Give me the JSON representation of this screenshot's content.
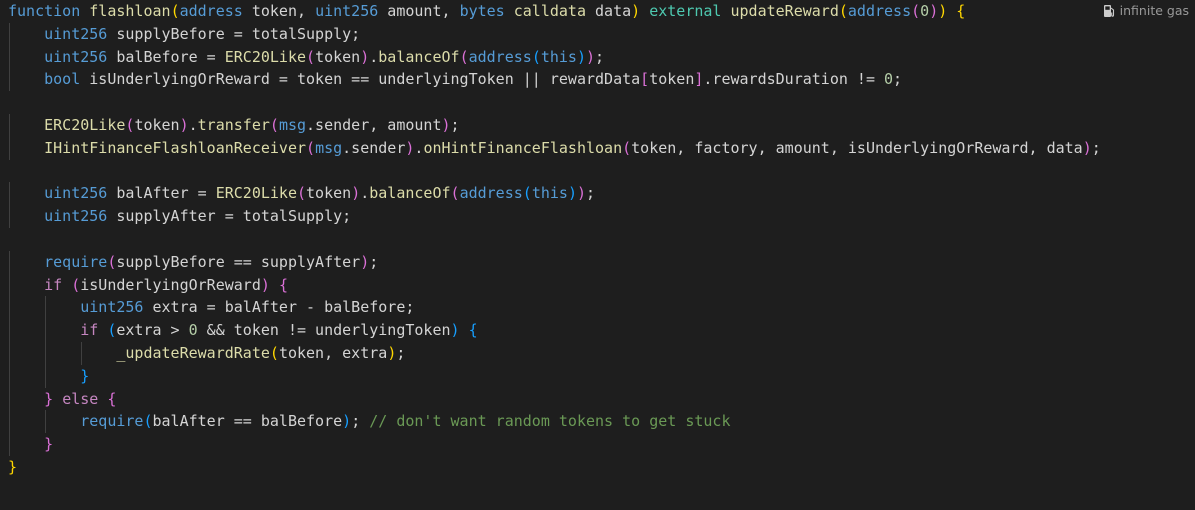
{
  "editor": {
    "codelens": {
      "icon": "fuel-pump-icon",
      "label": "infinite gas"
    },
    "theme": {
      "background": "#1e1e1e",
      "keyword": "#569cd6",
      "control": "#c586c0",
      "function": "#dcdcaa",
      "number": "#b5cea8",
      "comment": "#6a9955"
    },
    "lines": [
      [
        {
          "t": "function",
          "c": "kw"
        },
        {
          "t": " ",
          "c": "pl"
        },
        {
          "t": "flashloan",
          "c": "fn"
        },
        {
          "t": "(",
          "c": "b1"
        },
        {
          "t": "address",
          "c": "kw"
        },
        {
          "t": " token, ",
          "c": "pl"
        },
        {
          "t": "uint256",
          "c": "kw"
        },
        {
          "t": " amount, ",
          "c": "pl"
        },
        {
          "t": "bytes",
          "c": "kw"
        },
        {
          "t": " ",
          "c": "pl"
        },
        {
          "t": "calldata",
          "c": "fn"
        },
        {
          "t": " data",
          "c": "pl"
        },
        {
          "t": ")",
          "c": "b1"
        },
        {
          "t": " ",
          "c": "pl"
        },
        {
          "t": "external",
          "c": "mod"
        },
        {
          "t": " ",
          "c": "pl"
        },
        {
          "t": "updateReward",
          "c": "fn"
        },
        {
          "t": "(",
          "c": "b1"
        },
        {
          "t": "address",
          "c": "kw"
        },
        {
          "t": "(",
          "c": "b2"
        },
        {
          "t": "0",
          "c": "num"
        },
        {
          "t": ")",
          "c": "b2"
        },
        {
          "t": ")",
          "c": "b1"
        },
        {
          "t": " ",
          "c": "pl"
        },
        {
          "t": "{",
          "c": "b1"
        }
      ],
      [
        {
          "t": "    ",
          "c": "pl"
        },
        {
          "t": "uint256",
          "c": "kw"
        },
        {
          "t": " supplyBefore = totalSupply;",
          "c": "pl"
        }
      ],
      [
        {
          "t": "    ",
          "c": "pl"
        },
        {
          "t": "uint256",
          "c": "kw"
        },
        {
          "t": " balBefore = ",
          "c": "pl"
        },
        {
          "t": "ERC20Like",
          "c": "fn"
        },
        {
          "t": "(",
          "c": "b2"
        },
        {
          "t": "token",
          "c": "pl"
        },
        {
          "t": ")",
          "c": "b2"
        },
        {
          "t": ".",
          "c": "pl"
        },
        {
          "t": "balanceOf",
          "c": "fn"
        },
        {
          "t": "(",
          "c": "b2"
        },
        {
          "t": "address",
          "c": "kw"
        },
        {
          "t": "(",
          "c": "b3"
        },
        {
          "t": "this",
          "c": "kw"
        },
        {
          "t": ")",
          "c": "b3"
        },
        {
          "t": ")",
          "c": "b2"
        },
        {
          "t": ";",
          "c": "pl"
        }
      ],
      [
        {
          "t": "    ",
          "c": "pl"
        },
        {
          "t": "bool",
          "c": "kw"
        },
        {
          "t": " isUnderlyingOrReward = token == underlyingToken || rewardData",
          "c": "pl"
        },
        {
          "t": "[",
          "c": "b2"
        },
        {
          "t": "token",
          "c": "pl"
        },
        {
          "t": "]",
          "c": "b2"
        },
        {
          "t": ".rewardsDuration != ",
          "c": "pl"
        },
        {
          "t": "0",
          "c": "num"
        },
        {
          "t": ";",
          "c": "pl"
        }
      ],
      [],
      [
        {
          "t": "    ",
          "c": "pl"
        },
        {
          "t": "ERC20Like",
          "c": "fn"
        },
        {
          "t": "(",
          "c": "b2"
        },
        {
          "t": "token",
          "c": "pl"
        },
        {
          "t": ")",
          "c": "b2"
        },
        {
          "t": ".",
          "c": "pl"
        },
        {
          "t": "transfer",
          "c": "fn"
        },
        {
          "t": "(",
          "c": "b2"
        },
        {
          "t": "msg",
          "c": "kw"
        },
        {
          "t": ".sender, amount",
          "c": "pl"
        },
        {
          "t": ")",
          "c": "b2"
        },
        {
          "t": ";",
          "c": "pl"
        }
      ],
      [
        {
          "t": "    ",
          "c": "pl"
        },
        {
          "t": "IHintFinanceFlashloanReceiver",
          "c": "fn"
        },
        {
          "t": "(",
          "c": "b2"
        },
        {
          "t": "msg",
          "c": "kw"
        },
        {
          "t": ".sender",
          "c": "pl"
        },
        {
          "t": ")",
          "c": "b2"
        },
        {
          "t": ".",
          "c": "pl"
        },
        {
          "t": "onHintFinanceFlashloan",
          "c": "fn"
        },
        {
          "t": "(",
          "c": "b2"
        },
        {
          "t": "token, factory, amount, isUnderlyingOrReward, data",
          "c": "pl"
        },
        {
          "t": ")",
          "c": "b2"
        },
        {
          "t": ";",
          "c": "pl"
        }
      ],
      [],
      [
        {
          "t": "    ",
          "c": "pl"
        },
        {
          "t": "uint256",
          "c": "kw"
        },
        {
          "t": " balAfter = ",
          "c": "pl"
        },
        {
          "t": "ERC20Like",
          "c": "fn"
        },
        {
          "t": "(",
          "c": "b2"
        },
        {
          "t": "token",
          "c": "pl"
        },
        {
          "t": ")",
          "c": "b2"
        },
        {
          "t": ".",
          "c": "pl"
        },
        {
          "t": "balanceOf",
          "c": "fn"
        },
        {
          "t": "(",
          "c": "b2"
        },
        {
          "t": "address",
          "c": "kw"
        },
        {
          "t": "(",
          "c": "b3"
        },
        {
          "t": "this",
          "c": "kw"
        },
        {
          "t": ")",
          "c": "b3"
        },
        {
          "t": ")",
          "c": "b2"
        },
        {
          "t": ";",
          "c": "pl"
        }
      ],
      [
        {
          "t": "    ",
          "c": "pl"
        },
        {
          "t": "uint256",
          "c": "kw"
        },
        {
          "t": " supplyAfter = totalSupply;",
          "c": "pl"
        }
      ],
      [],
      [
        {
          "t": "    ",
          "c": "pl"
        },
        {
          "t": "require",
          "c": "kw"
        },
        {
          "t": "(",
          "c": "b2"
        },
        {
          "t": "supplyBefore == supplyAfter",
          "c": "pl"
        },
        {
          "t": ")",
          "c": "b2"
        },
        {
          "t": ";",
          "c": "pl"
        }
      ],
      [
        {
          "t": "    ",
          "c": "pl"
        },
        {
          "t": "if",
          "c": "ctl"
        },
        {
          "t": " ",
          "c": "pl"
        },
        {
          "t": "(",
          "c": "b2"
        },
        {
          "t": "isUnderlyingOrReward",
          "c": "pl"
        },
        {
          "t": ")",
          "c": "b2"
        },
        {
          "t": " ",
          "c": "pl"
        },
        {
          "t": "{",
          "c": "b2"
        }
      ],
      [
        {
          "t": "        ",
          "c": "pl"
        },
        {
          "t": "uint256",
          "c": "kw"
        },
        {
          "t": " extra = balAfter - balBefore;",
          "c": "pl"
        }
      ],
      [
        {
          "t": "        ",
          "c": "pl"
        },
        {
          "t": "if",
          "c": "ctl"
        },
        {
          "t": " ",
          "c": "pl"
        },
        {
          "t": "(",
          "c": "b3"
        },
        {
          "t": "extra > ",
          "c": "pl"
        },
        {
          "t": "0",
          "c": "num"
        },
        {
          "t": " && token != underlyingToken",
          "c": "pl"
        },
        {
          "t": ")",
          "c": "b3"
        },
        {
          "t": " ",
          "c": "pl"
        },
        {
          "t": "{",
          "c": "b3"
        }
      ],
      [
        {
          "t": "            ",
          "c": "pl"
        },
        {
          "t": "_updateRewardRate",
          "c": "fn"
        },
        {
          "t": "(",
          "c": "b1"
        },
        {
          "t": "token, extra",
          "c": "pl"
        },
        {
          "t": ")",
          "c": "b1"
        },
        {
          "t": ";",
          "c": "pl"
        }
      ],
      [
        {
          "t": "        ",
          "c": "pl"
        },
        {
          "t": "}",
          "c": "b3"
        }
      ],
      [
        {
          "t": "    ",
          "c": "pl"
        },
        {
          "t": "}",
          "c": "b2"
        },
        {
          "t": " ",
          "c": "pl"
        },
        {
          "t": "else",
          "c": "ctl"
        },
        {
          "t": " ",
          "c": "pl"
        },
        {
          "t": "{",
          "c": "b2"
        }
      ],
      [
        {
          "t": "        ",
          "c": "pl"
        },
        {
          "t": "require",
          "c": "kw"
        },
        {
          "t": "(",
          "c": "b3"
        },
        {
          "t": "balAfter == balBefore",
          "c": "pl"
        },
        {
          "t": ")",
          "c": "b3"
        },
        {
          "t": "; ",
          "c": "pl"
        },
        {
          "t": "// don't want random tokens to get stuck",
          "c": "cm"
        }
      ],
      [
        {
          "t": "    ",
          "c": "pl"
        },
        {
          "t": "}",
          "c": "b2"
        }
      ],
      [
        {
          "t": "}",
          "c": "b1"
        }
      ]
    ]
  }
}
